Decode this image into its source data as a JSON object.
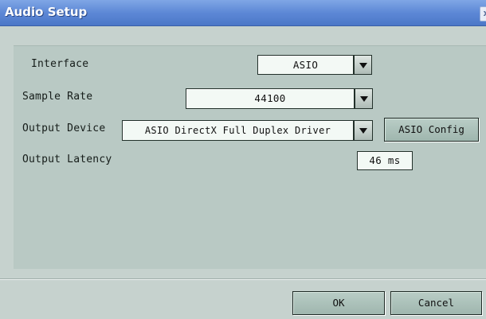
{
  "window": {
    "title": "Audio Setup",
    "close_glyph": "x"
  },
  "fields": {
    "interface": {
      "label": "Interface",
      "value": "ASIO"
    },
    "sample_rate": {
      "label": "Sample Rate",
      "value": "44100"
    },
    "output_device": {
      "label": "Output Device",
      "value": "ASIO DirectX Full Duplex Driver"
    },
    "output_latency": {
      "label": "Output Latency",
      "value": "46 ms"
    }
  },
  "buttons": {
    "asio_config": "ASIO Config",
    "ok": "OK",
    "cancel": "Cancel"
  },
  "icons": {
    "dropdown": "chevron-down-icon",
    "close": "close-icon"
  },
  "colors": {
    "titlebar": "#5d88d6",
    "window_bg": "#c6d2ce",
    "panel_bg": "#b9c9c4",
    "field_bg": "#f3f9f5",
    "button_bg": "#a9beb7"
  }
}
